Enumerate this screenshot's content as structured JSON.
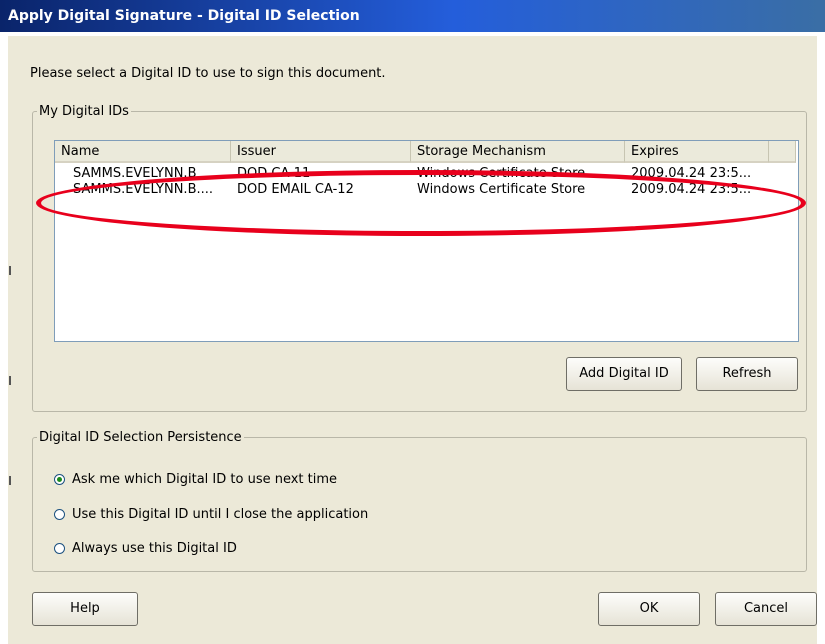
{
  "window": {
    "title": "Apply Digital Signature - Digital ID Selection"
  },
  "instruction": "Please select a Digital ID to use to sign this document.",
  "ids_group": {
    "legend": "My Digital IDs",
    "columns": [
      "Name",
      "Issuer",
      "Storage Mechanism",
      "Expires"
    ],
    "rows": [
      {
        "name": "SAMMS.EVELYNN.B",
        "issuer": "DOD CA-11",
        "storage": "Windows Certificate Store",
        "expires": "2009.04.24 23:5..."
      },
      {
        "name": "SAMMS.EVELYNN.B....",
        "issuer": "DOD EMAIL CA-12",
        "storage": "Windows Certificate Store",
        "expires": "2009.04.24 23:5..."
      }
    ],
    "buttons": {
      "add": "Add Digital ID",
      "refresh": "Refresh"
    }
  },
  "persistence": {
    "legend": "Digital ID Selection Persistence",
    "options": [
      {
        "label": "Ask me which Digital ID to use next time",
        "selected": true
      },
      {
        "label": "Use this Digital ID until I close the application",
        "selected": false
      },
      {
        "label": "Always use this Digital ID",
        "selected": false
      }
    ]
  },
  "footer": {
    "help": "Help",
    "ok": "OK",
    "cancel": "Cancel"
  },
  "colors": {
    "titlebar": "#0a246a",
    "highlight_ellipse": "#e8001c",
    "dialog_bg": "#ece9d8"
  }
}
